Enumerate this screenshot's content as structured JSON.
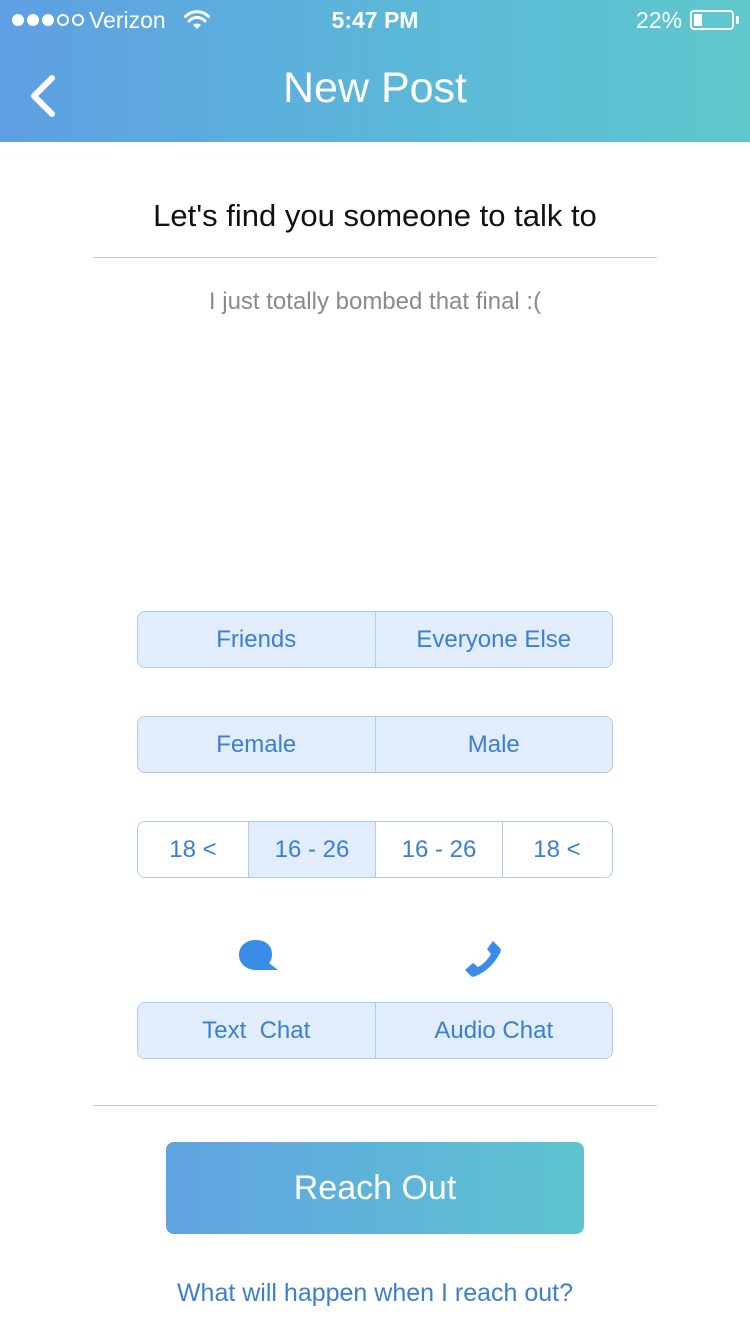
{
  "status_bar": {
    "carrier": "Verizon",
    "time": "5:47 PM",
    "battery_percent": "22%",
    "battery_level": 0.22,
    "signal_bars_filled": 3,
    "signal_bars_total": 5,
    "icons": [
      "wifi-icon",
      "battery-icon"
    ]
  },
  "nav": {
    "title": "New Post",
    "back_icon": "chevron-left-icon"
  },
  "prompt": "Let's find you someone to talk to",
  "post": {
    "text": "I just totally bombed that final :("
  },
  "audience": {
    "options": [
      "Friends",
      "Everyone Else"
    ]
  },
  "gender": {
    "options": [
      "Female",
      "Male"
    ]
  },
  "age": {
    "options": [
      "18 <",
      "16 - 26",
      "16 - 26",
      "18 <"
    ]
  },
  "chat_type": {
    "icons": [
      "speech-bubble-icon",
      "phone-icon"
    ],
    "options": [
      "Text  Chat",
      "Audio Chat"
    ]
  },
  "reach_out_label": "Reach Out",
  "help_link": "What will happen when I reach out?",
  "colors": {
    "header_gradient_start": "#5f9fe3",
    "header_gradient_end": "#5ec8cd",
    "accent_blue": "#3a7fd3",
    "segment_fill": "#e2edfb",
    "segment_border": "#a9cdf2"
  }
}
